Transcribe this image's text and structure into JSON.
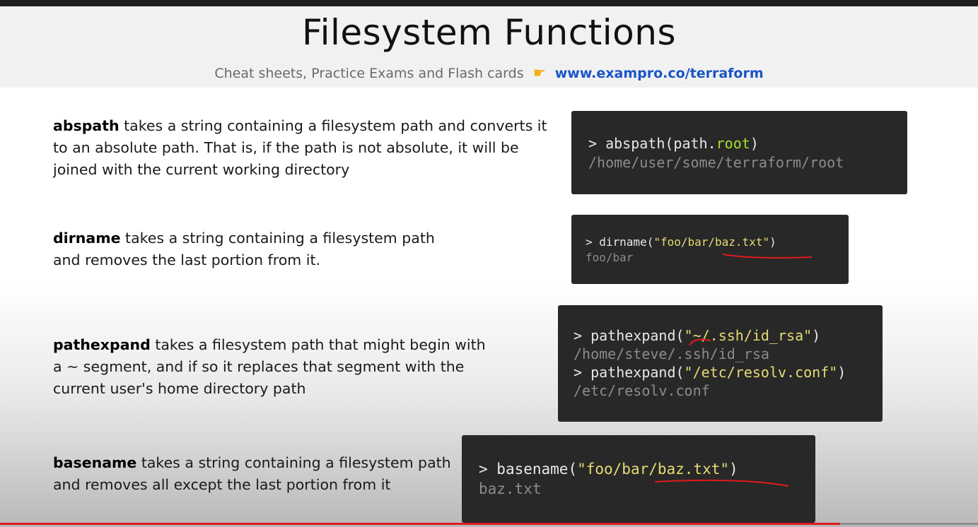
{
  "header": {
    "title": "Filesystem Functions",
    "subtitle_text": "Cheat sheets, Practice Exams and Flash cards",
    "subtitle_icon": "pointing-hand-icon",
    "subtitle_link": "www.exampro.co/terraform"
  },
  "sections": {
    "abspath": {
      "name": "abspath",
      "desc": " takes a string containing a filesystem path and converts it to an absolute path. That is, if the path is not absolute, it will be joined with the current working directory",
      "code": {
        "prompt": "> ",
        "fn": "abspath(path.",
        "arg": "root",
        "close": ")",
        "output": "/home/user/some/terraform/root"
      }
    },
    "dirname": {
      "name": "dirname",
      "desc": " takes a string containing a filesystem path and removes the last portion from it.",
      "code": {
        "prompt": "> ",
        "fn": "dirname(",
        "arg": "\"foo/bar/baz.txt\"",
        "close": ")",
        "output": "foo/bar"
      }
    },
    "pathexpand": {
      "name": "pathexpand",
      "desc": " takes a filesystem path that might begin with a ~ segment, and if so it replaces that segment with the current user's home directory path",
      "code": {
        "prompt": "> ",
        "fn": "pathexpand(",
        "arg": "\"~/.ssh/id_rsa\"",
        "close": ")",
        "output": "/home/steve/.ssh/id_rsa",
        "prompt2": "> ",
        "fn2": "pathexpand(",
        "arg2": "\"/etc/resolv.conf\"",
        "close2": ")",
        "output2": "/etc/resolv.conf"
      }
    },
    "basename": {
      "name": "basename",
      "desc": " takes a string containing a filesystem path and removes all except the last portion from it",
      "code": {
        "prompt": "> ",
        "fn": "basename(",
        "arg": "\"foo/bar/baz.txt\"",
        "close": ")",
        "output": "baz.txt"
      }
    }
  },
  "video": {
    "progress": 0.859
  },
  "colors": {
    "code_bg": "#282828",
    "keyword": "#a6e22e",
    "string": "#e6db74",
    "output": "#8c8c8c",
    "link": "#1a55c8",
    "annotation": "#e01a1a"
  }
}
